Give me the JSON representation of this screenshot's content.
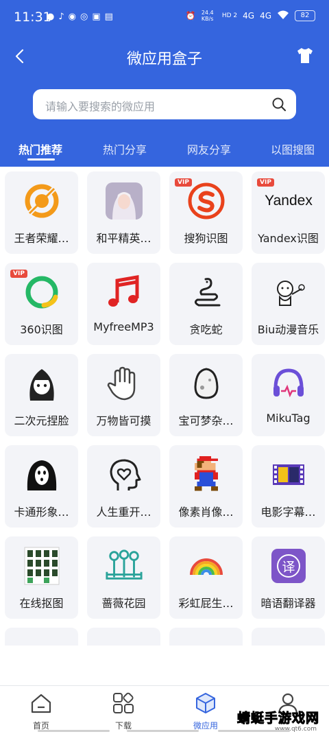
{
  "status": {
    "time": "11:31",
    "net_speed": "24.4 KB/s",
    "hd": "HD 2",
    "sig1": "4G",
    "sig2": "4G",
    "battery": "82"
  },
  "header": {
    "title": "微应用盒子",
    "back_icon": "chevron-left-icon",
    "right_icon": "tshirt-icon"
  },
  "search": {
    "placeholder": "请输入要搜索的微应用"
  },
  "tabs": [
    {
      "label": "热门推荐",
      "active": true
    },
    {
      "label": "热门分享"
    },
    {
      "label": "网友分享"
    },
    {
      "label": "以图搜图"
    }
  ],
  "apps": [
    {
      "label": "王者荣耀…",
      "icon": "target-icon",
      "vip": false
    },
    {
      "label": "和平精英…",
      "icon": "game-character-icon",
      "vip": false
    },
    {
      "label": "搜狗识图",
      "icon": "sogou-icon",
      "vip": true
    },
    {
      "label": "Yandex识图",
      "icon": "yandex-icon",
      "logo_text": "Yandex",
      "vip": true
    },
    {
      "label": "360识图",
      "icon": "ring-icon",
      "vip": true
    },
    {
      "label": "MyfreeMP3",
      "icon": "music-note-icon",
      "vip": false
    },
    {
      "label": "贪吃蛇",
      "icon": "snake-icon",
      "vip": false
    },
    {
      "label": "Biu动漫音乐",
      "icon": "cartoon-icon",
      "vip": false
    },
    {
      "label": "二次元捏脸",
      "icon": "anime-girl-icon",
      "vip": false
    },
    {
      "label": "万物皆可摸",
      "icon": "hand-icon",
      "vip": false
    },
    {
      "label": "宝可梦杂…",
      "icon": "egg-icon",
      "vip": false
    },
    {
      "label": "MikuTag",
      "icon": "headphones-icon",
      "vip": false
    },
    {
      "label": "卡通形象…",
      "icon": "ghost-face-icon",
      "vip": false
    },
    {
      "label": "人生重开…",
      "icon": "head-heart-icon",
      "vip": false
    },
    {
      "label": "像素肖像…",
      "icon": "pixel-mario-icon",
      "vip": false
    },
    {
      "label": "电影字幕…",
      "icon": "film-icon",
      "vip": false
    },
    {
      "label": "在线抠图",
      "icon": "sticker-sheet-icon",
      "vip": false
    },
    {
      "label": "蔷薇花园",
      "icon": "garden-icon",
      "vip": false
    },
    {
      "label": "彩虹屁生…",
      "icon": "rainbow-icon",
      "vip": false
    },
    {
      "label": "暗语翻译器",
      "icon": "translate-icon",
      "glyph": "译",
      "vip": false
    }
  ],
  "vip_badge": "VIP",
  "bottom_nav": [
    {
      "label": "首页",
      "icon": "home-icon"
    },
    {
      "label": "下载",
      "icon": "grid-icon"
    },
    {
      "label": "微应用",
      "icon": "cube-icon",
      "active": true
    },
    {
      "label": "",
      "icon": "user-icon"
    }
  ],
  "watermark": {
    "text": "蜻蜓手游戏网",
    "url": "www.qt6.com"
  },
  "colors": {
    "primary": "#3565de",
    "card": "#f3f4f8",
    "vip": "#e84a3c"
  }
}
